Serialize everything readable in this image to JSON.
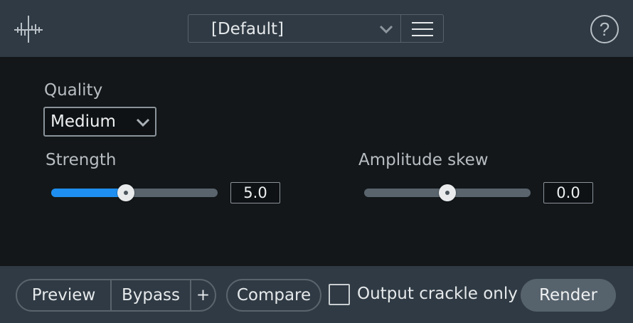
{
  "header": {
    "logo_icon": "waveform-logo-icon",
    "preset": {
      "selected": "[Default]",
      "dropdown_icon": "chevron-down-icon",
      "menu_icon": "hamburger-menu-icon"
    },
    "help_icon": "help-circle-icon"
  },
  "quality": {
    "label": "Quality",
    "selected": "Medium"
  },
  "strength": {
    "label": "Strength",
    "value": "5.0",
    "level": 0.45
  },
  "amplitude_skew": {
    "label": "Amplitude skew",
    "value": "0.0",
    "level": 0.5
  },
  "footer": {
    "preview_label": "Preview",
    "bypass_label": "Bypass",
    "add_label": "+",
    "compare_label": "Compare",
    "output_crackle_label": "Output crackle only",
    "output_crackle_checked": false,
    "render_label": "Render"
  },
  "colors": {
    "accent": "#1e8ff0",
    "header_bg": "#2f3a44",
    "panel_bg": "#131719"
  }
}
